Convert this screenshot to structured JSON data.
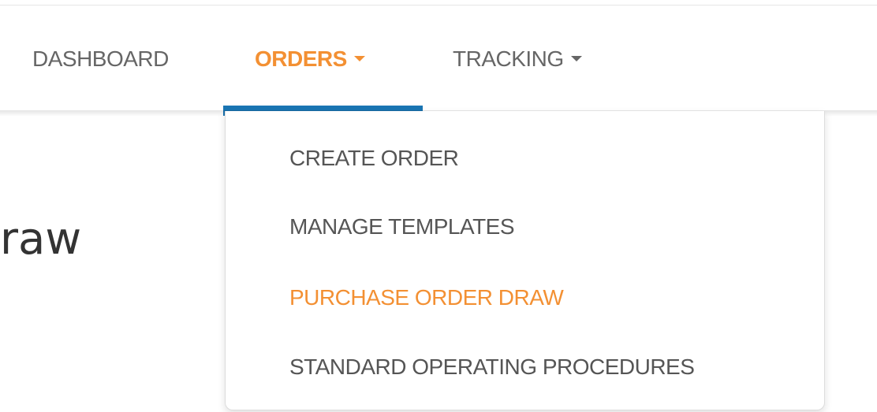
{
  "nav": {
    "items": [
      {
        "label": "DASHBOARD"
      },
      {
        "label": "ORDERS",
        "active": true
      },
      {
        "label": "TRACKING"
      }
    ]
  },
  "orders_menu": {
    "items": [
      {
        "label": "CREATE ORDER"
      },
      {
        "label": "MANAGE TEMPLATES"
      },
      {
        "label": "PURCHASE ORDER DRAW",
        "active": true
      },
      {
        "label": "STANDARD OPERATING PROCEDURES"
      }
    ]
  },
  "page": {
    "title_fragment": "raw"
  },
  "colors": {
    "accent": "#f39033",
    "active_tab_underline": "#1a75b3",
    "nav_text": "#666666",
    "menu_text": "#555555"
  }
}
